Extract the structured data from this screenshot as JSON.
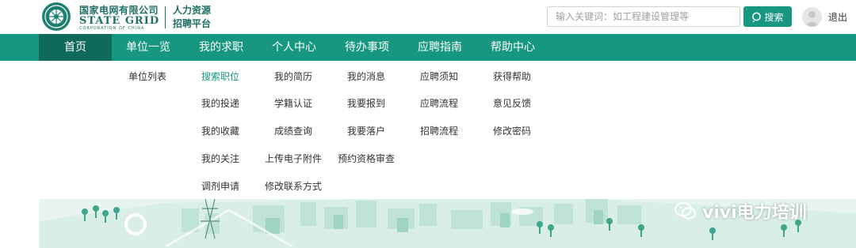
{
  "brand": {
    "company_cn": "国家电网有限公司",
    "company_en": "STATE GRID",
    "company_en_sub": "CORPORATION OF CHINA",
    "platform_line1": "人力资源",
    "platform_line2": "招聘平台",
    "primary_color": "#17977f"
  },
  "search": {
    "placeholder": "输入关键词：如工程建设管理等",
    "button_label": "搜索"
  },
  "user": {
    "logout_label": "退出"
  },
  "nav": {
    "items": [
      {
        "label": "首页",
        "active": true
      },
      {
        "label": "单位一览"
      },
      {
        "label": "我的求职"
      },
      {
        "label": "个人中心"
      },
      {
        "label": "待办事项"
      },
      {
        "label": "应聘指南"
      },
      {
        "label": "帮助中心"
      }
    ]
  },
  "submenu": {
    "units": [
      "单位列表"
    ],
    "job_search": [
      "搜索职位",
      "我的投递",
      "我的收藏",
      "我的关注",
      "调剂申请"
    ],
    "personal": [
      "我的简历",
      "学籍认证",
      "成绩查询",
      "上传电子附件",
      "修改联系方式"
    ],
    "todo": [
      "我的消息",
      "我要报到",
      "我要落户",
      "预约资格审查"
    ],
    "guide": [
      "应聘须知",
      "应聘流程",
      "招聘流程"
    ],
    "help": [
      "获得帮助",
      "意见反馈",
      "修改密码"
    ]
  },
  "watermark": {
    "text": "vivi电力培训"
  }
}
